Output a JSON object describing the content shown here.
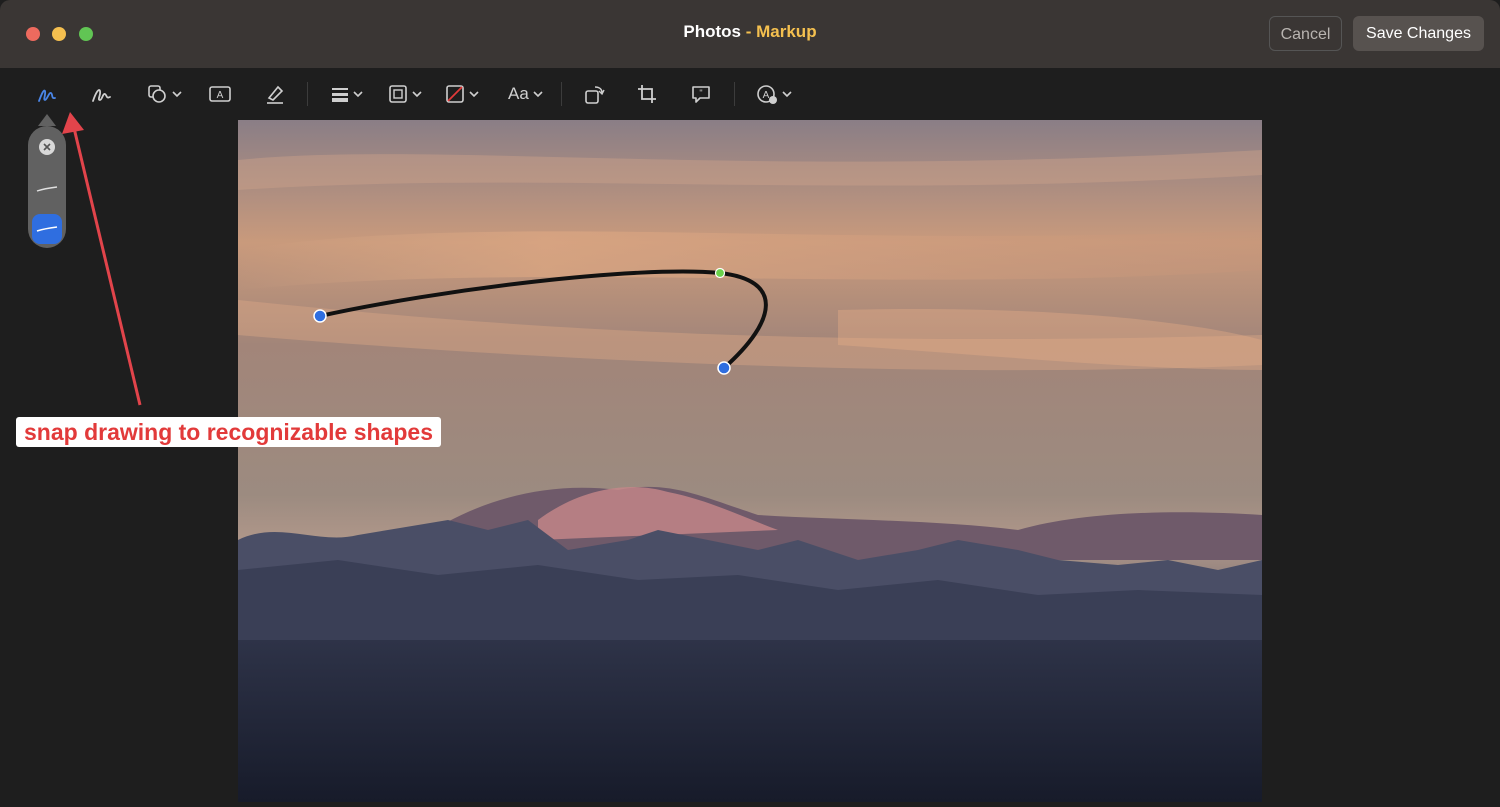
{
  "window": {
    "title_app": "Photos",
    "title_sep": " - ",
    "title_mode": "Markup"
  },
  "buttons": {
    "cancel": "Cancel",
    "save": "Save Changes"
  },
  "toolbar": {
    "tools": [
      {
        "icon": "sketch-pen-icon",
        "active": true
      },
      {
        "icon": "draw-icon"
      },
      {
        "icon": "shapes-icon",
        "has_menu": true
      },
      {
        "icon": "text-box-icon"
      },
      {
        "icon": "highlight-icon"
      },
      {
        "icon": "line-style-icon",
        "has_menu": true
      },
      {
        "icon": "border-color-icon",
        "has_menu": true
      },
      {
        "icon": "fill-color-icon",
        "has_menu": true
      },
      {
        "icon": "text-style-icon",
        "has_menu": true
      },
      {
        "icon": "rotate-icon"
      },
      {
        "icon": "crop-icon"
      },
      {
        "icon": "description-icon"
      },
      {
        "icon": "accessibility-icon",
        "has_menu": true
      }
    ],
    "text_style_label": "Aa",
    "accent_color": "#4a86e8"
  },
  "popover": {
    "items": [
      {
        "icon": "close-icon"
      },
      {
        "icon": "freeform-line-icon"
      },
      {
        "icon": "snap-shape-line-icon",
        "selected": true
      }
    ],
    "selected_color": "#2f6ee0"
  },
  "annotation": {
    "label": "snap drawing to recognizable shapes",
    "color": "#e23a3a"
  }
}
